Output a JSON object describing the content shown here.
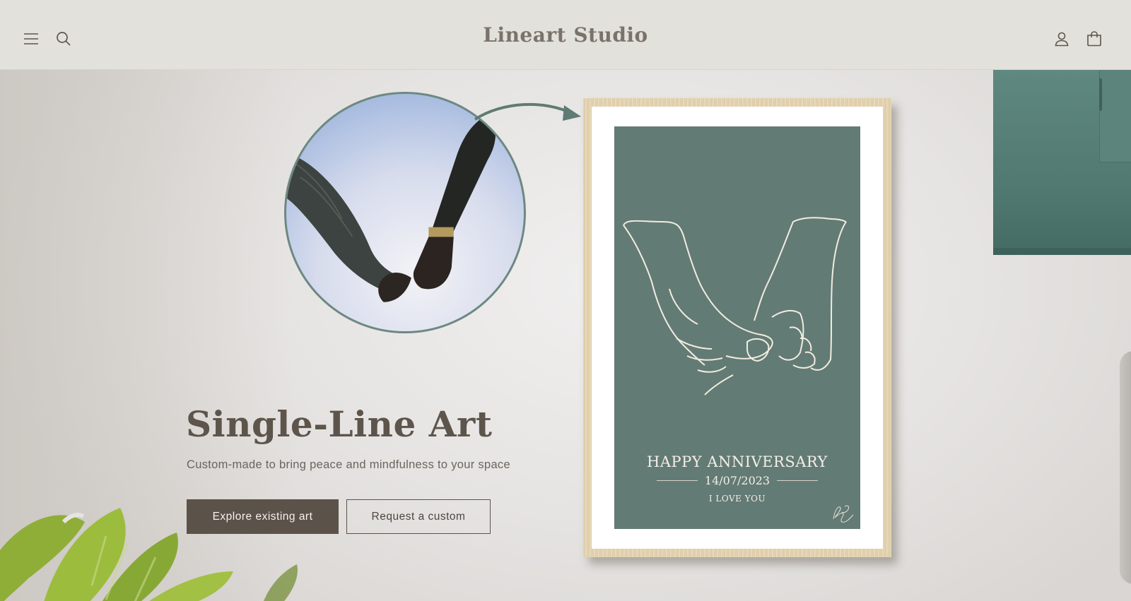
{
  "header": {
    "brand": "Lineart Studio",
    "icons": {
      "menu": "menu-icon",
      "search": "search-icon",
      "account": "account-icon",
      "cart": "cart-icon"
    }
  },
  "hero": {
    "title": "Single-Line Art",
    "subtitle": "Custom-made to bring peace and mindfulness to your space",
    "primary_button": "Explore existing art",
    "secondary_button": "Request a custom",
    "poster": {
      "title": "HAPPY ANNIVERSARY",
      "date": "14/07/2023",
      "message": "I LOVE YOU"
    }
  },
  "colors": {
    "header_bg": "#e2e1db",
    "brand_text": "#7a736b",
    "primary_button_bg": "#5b524a",
    "poster_bg": "#637b75",
    "accent_green": "#6d8882"
  }
}
